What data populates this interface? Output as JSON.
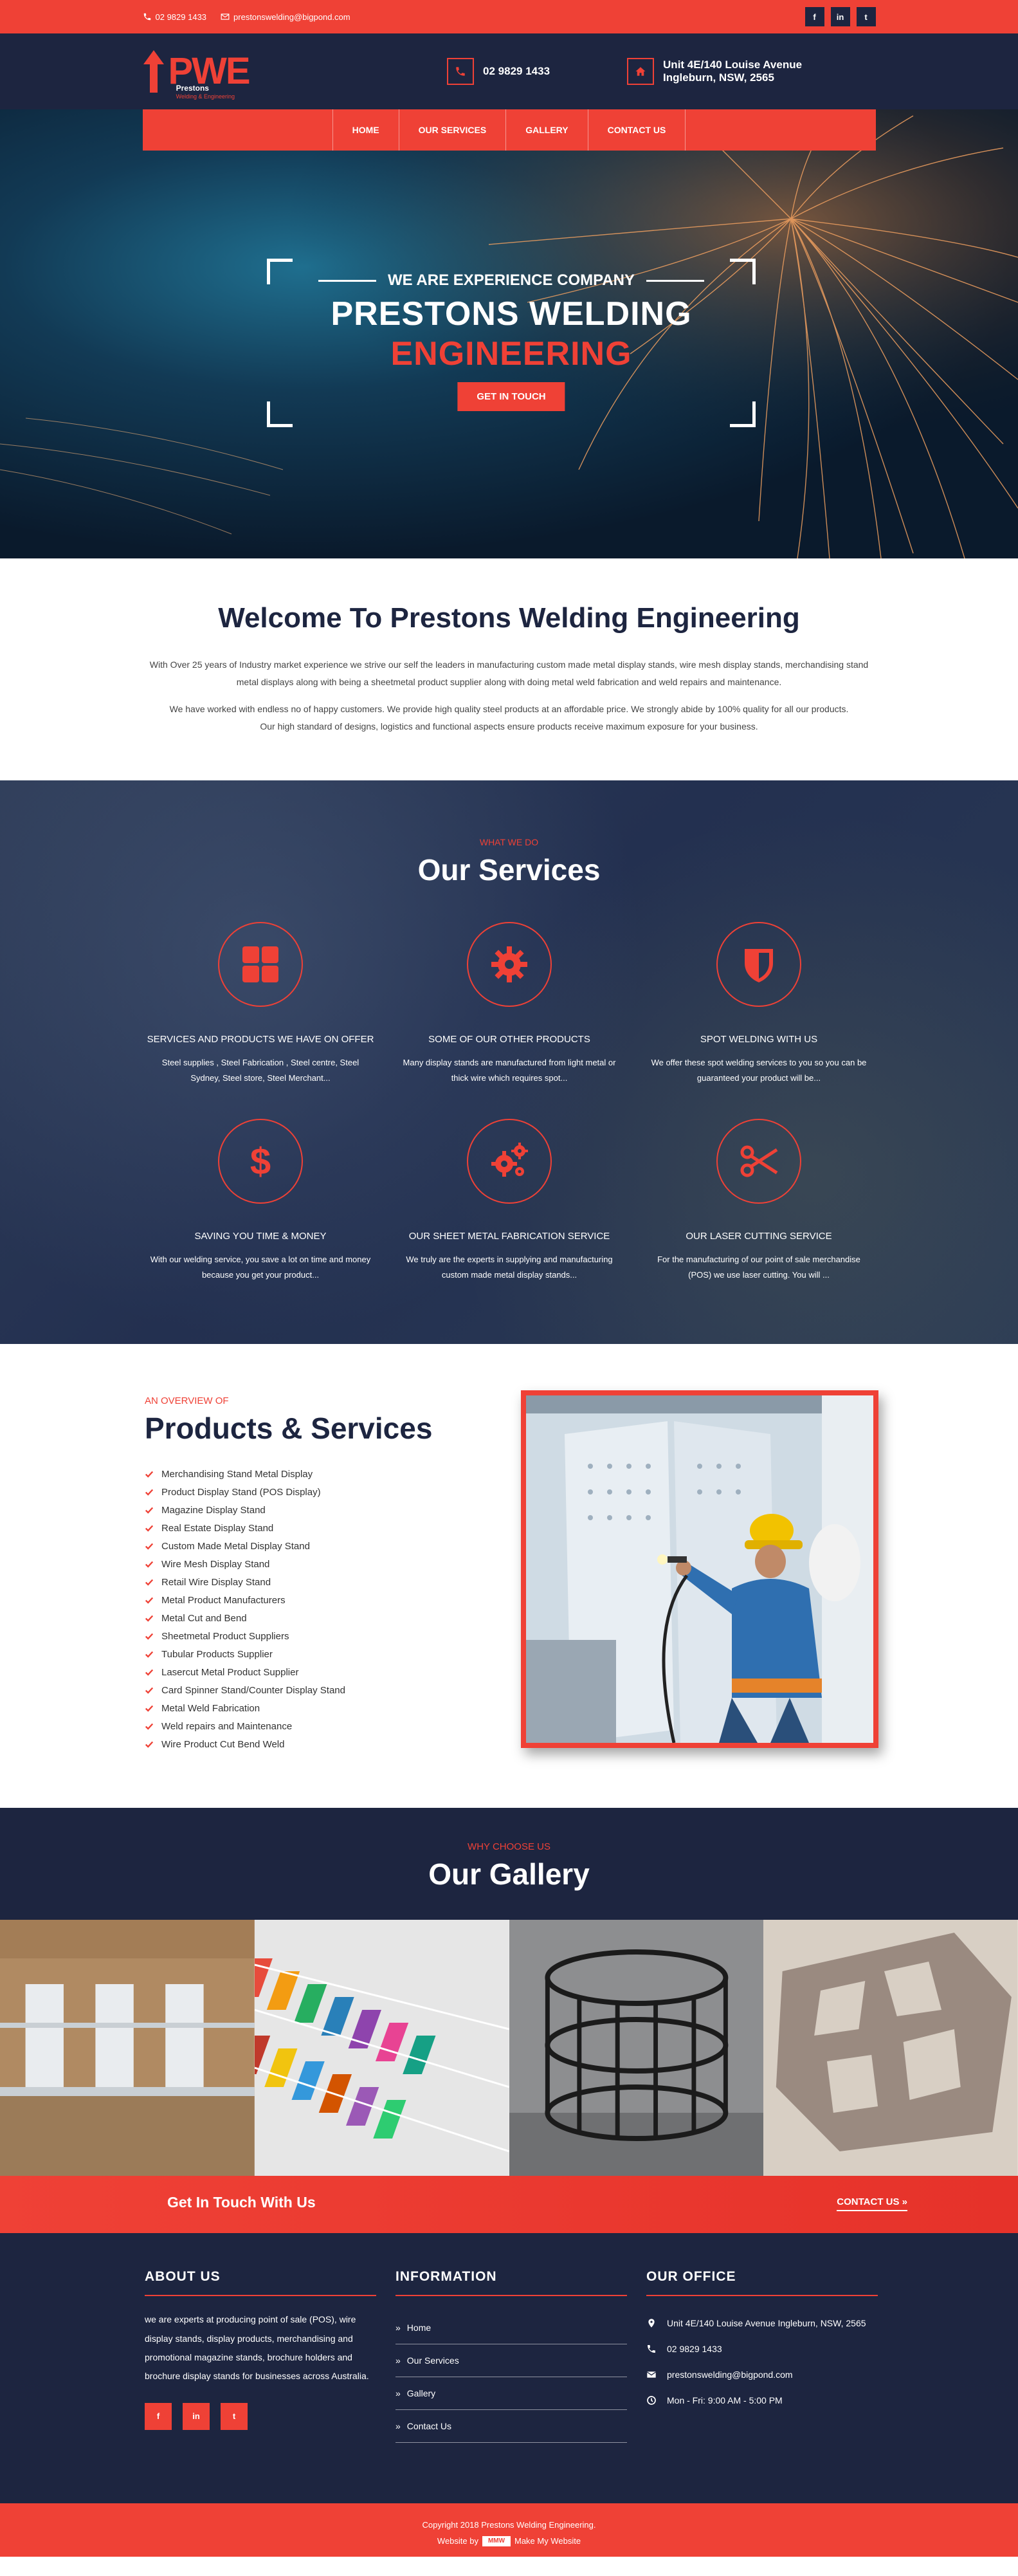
{
  "topbar": {
    "phone": "02 9829 1433",
    "email": "prestonswelding@bigpond.com",
    "socials": [
      "f",
      "in",
      "t"
    ]
  },
  "header": {
    "logo_text": "PWE",
    "logo_brand": "Prestons",
    "logo_tagline": "Welding & Engineering",
    "phone": "02 9829 1433",
    "address_line1": "Unit 4E/140 Louise Avenue",
    "address_line2": "Ingleburn, NSW, 2565"
  },
  "nav": {
    "items": [
      "HOME",
      "OUR SERVICES",
      "GALLERY",
      "CONTACT US"
    ]
  },
  "hero": {
    "tagline": "WE ARE EXPERIENCE COMPANY",
    "title_line1": "PRESTONS WELDING",
    "title_line2": "ENGINEERING",
    "cta": "GET IN TOUCH"
  },
  "welcome": {
    "title": "Welcome To Prestons Welding Engineering",
    "p1": "With Over 25 years of Industry market experience we strive our self the leaders in manufacturing custom made metal display stands, wire mesh display stands, merchandising stand metal displays along with being a sheetmetal product supplier along with doing metal weld fabrication and weld repairs and maintenance.",
    "p2": "We have worked with endless no of happy customers. We provide high quality steel products at an affordable price. We strongly abide by 100% quality for all our products.",
    "p3": "Our high standard of designs, logistics and functional aspects ensure products receive maximum exposure for your business."
  },
  "services": {
    "eyebrow": "WHAT WE DO",
    "title": "Our Services",
    "items": [
      {
        "icon": "grid-icon",
        "title": "SERVICES AND PRODUCTS WE HAVE ON OFFER",
        "text": "Steel supplies , Steel Fabrication , Steel centre, Steel Sydney, Steel store, Steel Merchant..."
      },
      {
        "icon": "gear-icon",
        "title": "SOME OF OUR OTHER PRODUCTS",
        "text": "Many display stands are manufactured from light metal or thick wire which requires spot..."
      },
      {
        "icon": "shield-icon",
        "title": "SPOT WELDING WITH US",
        "text": "We offer these spot welding services to you so you can be guaranteed your product will be..."
      },
      {
        "icon": "dollar-icon",
        "title": "SAVING YOU TIME & MONEY",
        "text": "With our welding service, you save a lot on time and money because you get your product..."
      },
      {
        "icon": "gears-icon",
        "title": "OUR SHEET METAL FABRICATION SERVICE",
        "text": "We truly are the experts in supplying and manufacturing custom made metal display stands..."
      },
      {
        "icon": "scissors-icon",
        "title": "OUR LASER CUTTING SERVICE",
        "text": "For the manufacturing of our point of sale merchandise (POS) we use laser cutting. You will ..."
      }
    ]
  },
  "products": {
    "eyebrow": "AN OVERVIEW OF",
    "title": "Products & Services",
    "list": [
      "Merchandising Stand Metal Display",
      "Product Display Stand (POS Display)",
      "Magazine Display Stand",
      "Real Estate Display Stand",
      "Custom Made Metal Display Stand",
      "Wire Mesh Display Stand",
      "Retail Wire Display Stand",
      "Metal Product Manufacturers",
      "Metal Cut and Bend",
      "Sheetmetal Product Suppliers",
      "Tubular Products Supplier",
      "Lasercut Metal Product Supplier",
      "Card Spinner Stand/Counter Display Stand",
      "Metal Weld Fabrication",
      "Weld repairs and Maintenance",
      "Wire Product Cut Bend Weld"
    ]
  },
  "gallery": {
    "eyebrow": "WHY CHOOSE US",
    "title": "Our Gallery"
  },
  "strip": {
    "label": "Get In Touch With Us",
    "button": "CONTACT US"
  },
  "footer": {
    "about_title": "ABOUT US",
    "about_text": "we are experts at producing point of sale (POS), wire display stands, display products, merchandising and promotional magazine stands, brochure holders and brochure display stands for businesses across Australia.",
    "info_title": "INFORMATION",
    "links": [
      "Home",
      "Our Services",
      "Gallery",
      "Contact Us"
    ],
    "office_title": "OUR OFFICE",
    "address": "Unit 4E/140 Louise Avenue Ingleburn, NSW, 2565",
    "phone": "02 9829 1433",
    "email": "prestonswelding@bigpond.com",
    "hours": "Mon - Fri: 9:00 AM - 5:00 PM"
  },
  "copyright": {
    "line1": "Copyright 2018 Prestons Welding Engineering.",
    "website_by": "Website by",
    "logo": "MMW",
    "maker": "Make My Website"
  },
  "colors": {
    "accent": "#ef4136",
    "navy": "#1d2540"
  }
}
